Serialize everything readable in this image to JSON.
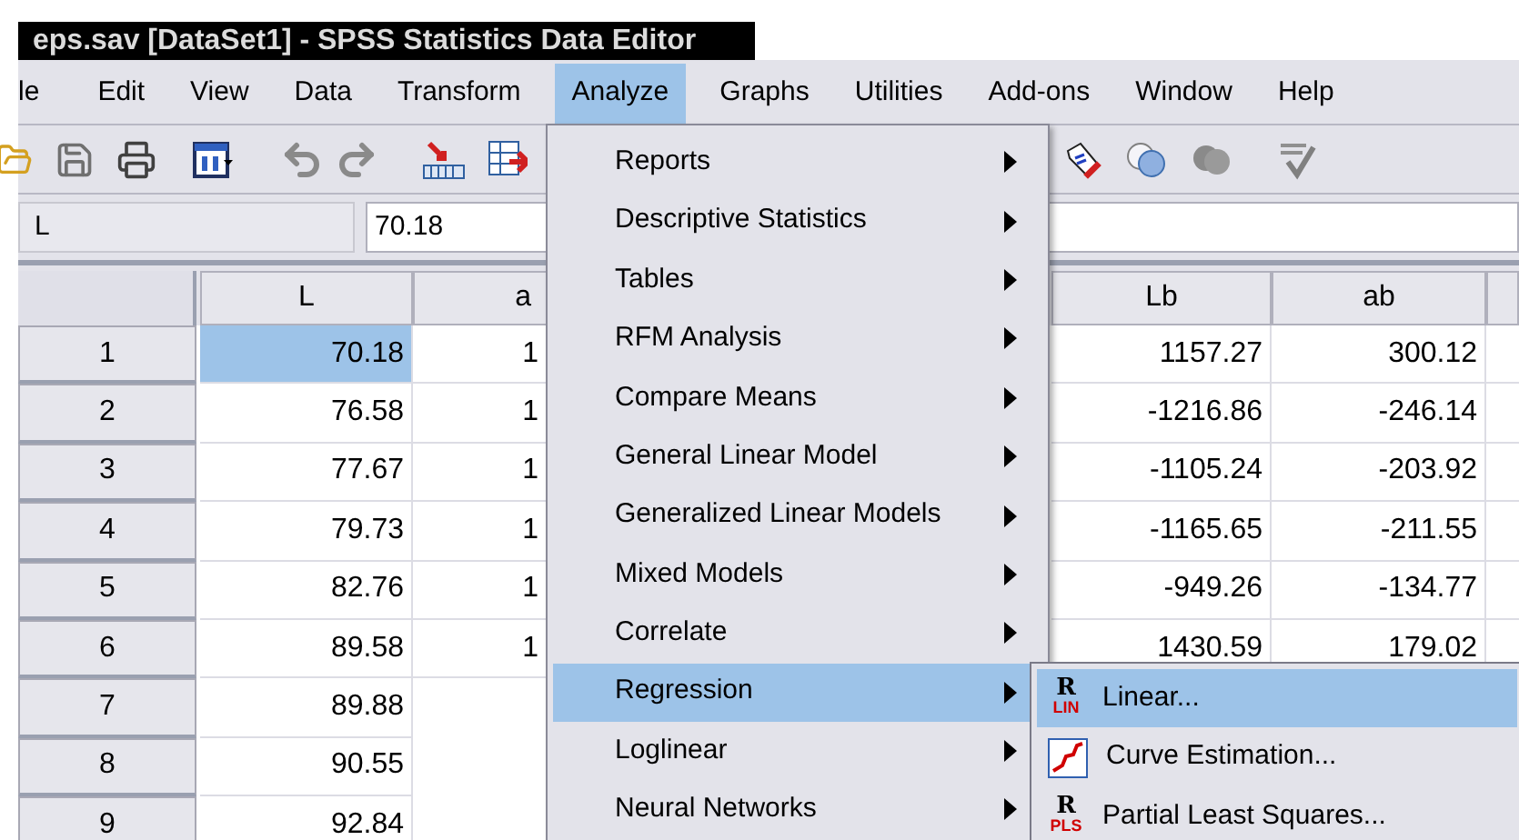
{
  "window": {
    "title": "eps.sav [DataSet1] - SPSS Statistics Data Editor"
  },
  "menu_bar": [
    {
      "label": "le",
      "selected": false
    },
    {
      "label": "Edit",
      "selected": false
    },
    {
      "label": "View",
      "selected": false
    },
    {
      "label": "Data",
      "selected": false
    },
    {
      "label": "Transform",
      "selected": false
    },
    {
      "label": "Analyze",
      "selected": true
    },
    {
      "label": "Graphs",
      "selected": false
    },
    {
      "label": "Utilities",
      "selected": false
    },
    {
      "label": "Add-ons",
      "selected": false
    },
    {
      "label": "Window",
      "selected": false
    },
    {
      "label": "Help",
      "selected": false
    }
  ],
  "cell_reference": {
    "name": "L",
    "value": "70.18"
  },
  "grid": {
    "columns": [
      "L",
      "a",
      "Lb",
      "ab"
    ],
    "rows": [
      {
        "number": "1",
        "cells": [
          {
            "value": "70.18",
            "selected": true
          },
          {
            "value": "1",
            "selected": false
          },
          {
            "value": "1157.27",
            "selected": false
          },
          {
            "value": "300.12",
            "selected": false
          }
        ]
      },
      {
        "number": "2",
        "cells": [
          {
            "value": "76.58",
            "selected": false
          },
          {
            "value": "1",
            "selected": false
          },
          {
            "value": "-1216.86",
            "selected": false
          },
          {
            "value": "-246.14",
            "selected": false
          }
        ]
      },
      {
        "number": "3",
        "cells": [
          {
            "value": "77.67",
            "selected": false
          },
          {
            "value": "1",
            "selected": false
          },
          {
            "value": "-1105.24",
            "selected": false
          },
          {
            "value": "-203.92",
            "selected": false
          }
        ]
      },
      {
        "number": "4",
        "cells": [
          {
            "value": "79.73",
            "selected": false
          },
          {
            "value": "1",
            "selected": false
          },
          {
            "value": "-1165.65",
            "selected": false
          },
          {
            "value": "-211.55",
            "selected": false
          }
        ]
      },
      {
        "number": "5",
        "cells": [
          {
            "value": "82.76",
            "selected": false
          },
          {
            "value": "1",
            "selected": false
          },
          {
            "value": "-949.26",
            "selected": false
          },
          {
            "value": "-134.77",
            "selected": false
          }
        ]
      },
      {
        "number": "6",
        "cells": [
          {
            "value": "89.58",
            "selected": false
          },
          {
            "value": "1",
            "selected": false
          },
          {
            "value": "1430.59",
            "selected": false
          },
          {
            "value": "179.02",
            "selected": false
          }
        ]
      },
      {
        "number": "7",
        "cells": [
          {
            "value": "89.88",
            "selected": false
          }
        ]
      },
      {
        "number": "8",
        "cells": [
          {
            "value": "90.55",
            "selected": false
          }
        ]
      },
      {
        "number": "9",
        "cells": [
          {
            "value": "92.84",
            "selected": false
          }
        ]
      }
    ]
  },
  "analyze_menu": {
    "items": [
      {
        "label": "Reports",
        "selected": false
      },
      {
        "label": "Descriptive Statistics",
        "selected": false
      },
      {
        "label": "Tables",
        "selected": false
      },
      {
        "label": "RFM Analysis",
        "selected": false
      },
      {
        "label": "Compare Means",
        "selected": false
      },
      {
        "label": "General Linear Model",
        "selected": false
      },
      {
        "label": "Generalized Linear Models",
        "selected": false
      },
      {
        "label": "Mixed Models",
        "selected": false
      },
      {
        "label": "Correlate",
        "selected": false
      },
      {
        "label": "Regression",
        "selected": true
      },
      {
        "label": "Loglinear",
        "selected": false
      },
      {
        "label": "Neural Networks",
        "selected": false
      }
    ]
  },
  "regression_submenu": {
    "items": [
      {
        "label": "Linear...",
        "selected": true,
        "kind": "r-icon",
        "icon_letter": "R",
        "icon_tag": "LIN"
      },
      {
        "label": "Curve Estimation...",
        "selected": false,
        "kind": "curve-icon"
      },
      {
        "label": "Partial Least Squares...",
        "selected": false,
        "kind": "r-icon",
        "icon_letter": "R",
        "icon_tag": "PLS"
      }
    ]
  }
}
